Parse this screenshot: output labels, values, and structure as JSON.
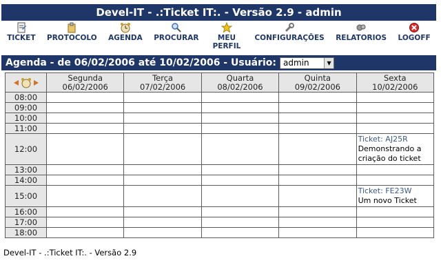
{
  "app": {
    "title": "Devel-IT - .:Ticket IT:. - Versão 2.9 - admin"
  },
  "menu": [
    {
      "label": "TICKET",
      "icon": "ticket-icon"
    },
    {
      "label": "PROTOCOLO",
      "icon": "protocol-icon"
    },
    {
      "label": "AGENDA",
      "icon": "agenda-icon"
    },
    {
      "label": "PROCURAR",
      "icon": "search-icon"
    },
    {
      "label": "MEU PERFIL",
      "icon": "star-icon"
    },
    {
      "label": "CONFIGURAÇÕES",
      "icon": "wrench-icon"
    },
    {
      "label": "RELATORIOS",
      "icon": "report-icon"
    },
    {
      "label": "LOGOFF",
      "icon": "logoff-icon"
    }
  ],
  "agenda": {
    "header": "Agenda - de 06/02/2006 até 10/02/2006 - Usuário:",
    "user_select": "admin",
    "days": [
      {
        "name": "Segunda",
        "date": "06/02/2006"
      },
      {
        "name": "Terça",
        "date": "07/02/2006"
      },
      {
        "name": "Quarta",
        "date": "08/02/2006"
      },
      {
        "name": "Quinta",
        "date": "09/02/2006"
      },
      {
        "name": "Sexta",
        "date": "10/02/2006"
      }
    ],
    "hours": [
      "08:00",
      "09:00",
      "10:00",
      "11:00",
      "12:00",
      "13:00",
      "14:00",
      "15:00",
      "16:00",
      "17:00",
      "18:00"
    ],
    "tickets": {
      "t1": {
        "id": "Ticket: AJ25R",
        "desc": "Demonstrando a criação do ticket"
      },
      "t2": {
        "id": "Ticket: FE23W",
        "desc": "Um novo Ticket"
      }
    }
  },
  "footer": "Devel-IT - .:Ticket IT:. - Versão 2.9",
  "colors": {
    "header_bg": "#1f3669",
    "today": "#e31e1e",
    "ticket_id": "#3d5a86"
  }
}
